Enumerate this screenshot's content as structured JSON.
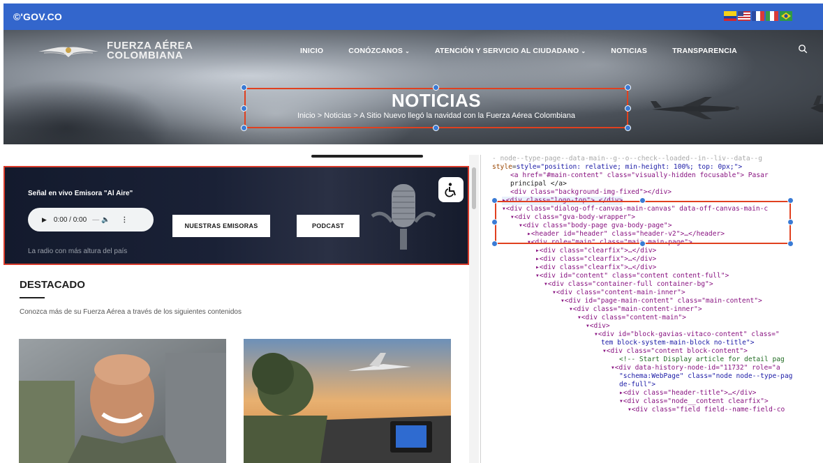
{
  "gov": {
    "logo": "©'GOV.CO"
  },
  "header": {
    "brand_line1": "FUERZA AÉREA",
    "brand_line2": "COLOMBIANA",
    "nav": [
      {
        "label": "INICIO"
      },
      {
        "label": "CONÓZCANOS"
      },
      {
        "label": "ATENCIÓN Y SERVICIO AL CIUDADANO"
      },
      {
        "label": "NOTICIAS"
      },
      {
        "label": "TRANSPARENCIA"
      }
    ]
  },
  "hero": {
    "title": "NOTICIAS",
    "breadcrumb": "Inicio  >  Noticias  >  A Sitio Nuevo llegó la navidad con la Fuerza Aérea Colombiana"
  },
  "radio": {
    "title": "Señal en vivo Emisora \"Al Aire\"",
    "time": "0:00 / 0:00",
    "btn_emisoras": "NUESTRAS EMISORAS",
    "btn_podcast": "PODCAST",
    "subtitle": "La radio con más altura del país"
  },
  "destacado": {
    "title": "DESTACADO",
    "subtitle": "Conozca más de su Fuerza Aérea a través de los siguientes contenidos"
  },
  "devtools": {
    "lines": [
      "- node--type-page--data-main--g--o--check--loaded--in--liv--data--g",
      "style=\"position: relative; min-height: 100%; top: 0px;\">",
      "<a href=\"#main-content\" class=\"visually-hidden focusable\"> Pasar",
      "principal </a>",
      "<div class=\"background-img-fixed\"></div>",
      "▸<div class=\"logo-top\">…</div>",
      "▾<div class=\"dialog-off-canvas-main-canvas\" data-off-canvas-main-c",
      "▾<div class=\"gva-body-wrapper\">",
      "▾<div class=\"body-page gva-body-page\">",
      "▸<header id=\"header\" class=\"header-v2\">…</header>",
      "▾<div role=\"main\" class=\"main main-page\">",
      "▸<div class=\"clearfix\">…</div>",
      "▸<div class=\"clearfix\">…</div>",
      "▸<div class=\"clearfix\">…</div>",
      "▾<div id=\"content\" class=\"content content-full\">",
      "▾<div class=\"container-full container-bg\">",
      "▾<div class=\"content-main-inner\">",
      "▾<div id=\"page-main-content\" class=\"main-content\">",
      "▾<div class=\"main-content-inner\">",
      "▾<div class=\"content-main\">",
      "▾<div>",
      "▾<div id=\"block-gavias-vitaco-content\" class=\"",
      "tem block-system-main-block no-title\">",
      "▾<div class=\"content block-content\">",
      "<!-- Start Display article for detail pag",
      "▾<div data-history-node-id=\"11732\" role=\"a",
      "\"schema:WebPage\" class=\"node node--type-pag",
      "de-full\">",
      "▸<div class=\"header-title\">…</div>",
      "▾<div class=\"node__content clearfix\">",
      "▾<div class=\"field field--name-field-co"
    ]
  },
  "colors": {
    "gov_blue": "#3366cc",
    "highlight_red": "#e0401f",
    "handle_blue": "#3a7bd5"
  },
  "icons": [
    "search-icon",
    "chevron-down-icon",
    "play-icon",
    "volume-icon",
    "more-options-icon",
    "accessibility-icon",
    "microphone-icon",
    "eagle-logo-icon"
  ]
}
